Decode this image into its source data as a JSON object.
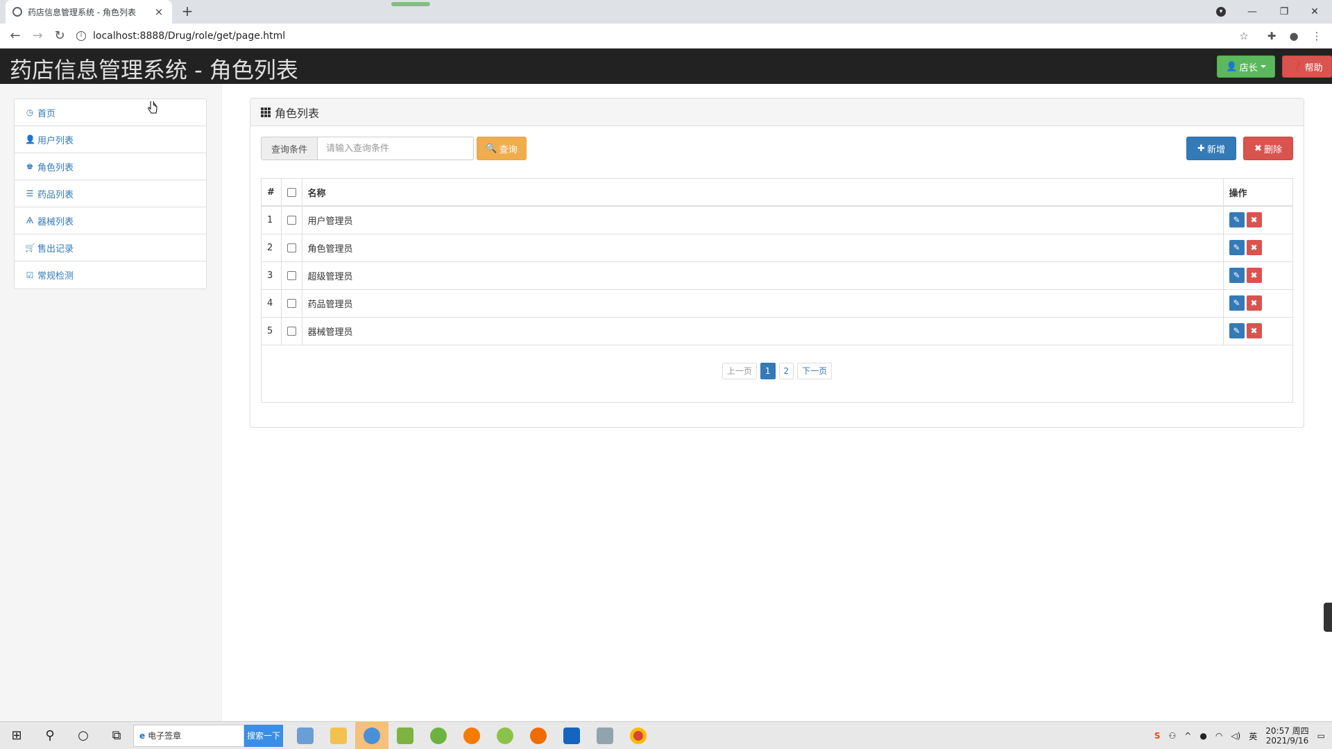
{
  "browser": {
    "tab_title": "药店信息管理系统 - 角色列表",
    "tab_close": "×",
    "new_tab": "+",
    "url": "localhost:8888/Drug/role/get/page.html"
  },
  "header": {
    "app_title": "药店信息管理系统 - 角色列表",
    "user_button": "店长",
    "help_button": "帮助"
  },
  "sidebar": {
    "items": [
      {
        "label": "首页",
        "icon": "clock-icon"
      },
      {
        "label": "用户列表",
        "icon": "user-icon"
      },
      {
        "label": "角色列表",
        "icon": "role-icon"
      },
      {
        "label": "药品列表",
        "icon": "list-icon"
      },
      {
        "label": "器械列表",
        "icon": "instrument-icon"
      },
      {
        "label": "售出记录",
        "icon": "cart-icon"
      },
      {
        "label": "常规检测",
        "icon": "check-icon"
      }
    ]
  },
  "panel": {
    "title": "角色列表",
    "search_label": "查询条件",
    "search_placeholder": "请输入查询条件",
    "search_button": "查询",
    "add_button": "新增",
    "delete_button": "删除"
  },
  "table": {
    "headers": {
      "index": "#",
      "name": "名称",
      "actions": "操作"
    },
    "rows": [
      {
        "index": "1",
        "name": "用户管理员"
      },
      {
        "index": "2",
        "name": "角色管理员"
      },
      {
        "index": "3",
        "name": "超级管理员"
      },
      {
        "index": "4",
        "name": "药品管理员"
      },
      {
        "index": "5",
        "name": "器械管理员"
      }
    ]
  },
  "pager": {
    "prev": "上一页",
    "pages": [
      "1",
      "2"
    ],
    "current": "1",
    "next": "下一页"
  },
  "taskbar": {
    "search_text": "电子签章",
    "search_button": "搜索一下",
    "ime": "英",
    "time": "20:57 周四",
    "date": "2021/9/16"
  },
  "colors": {
    "primary": "#337ab7",
    "success": "#5cb85c",
    "danger": "#d9534f",
    "warning": "#f0ad4e",
    "header_bg": "#222222"
  }
}
